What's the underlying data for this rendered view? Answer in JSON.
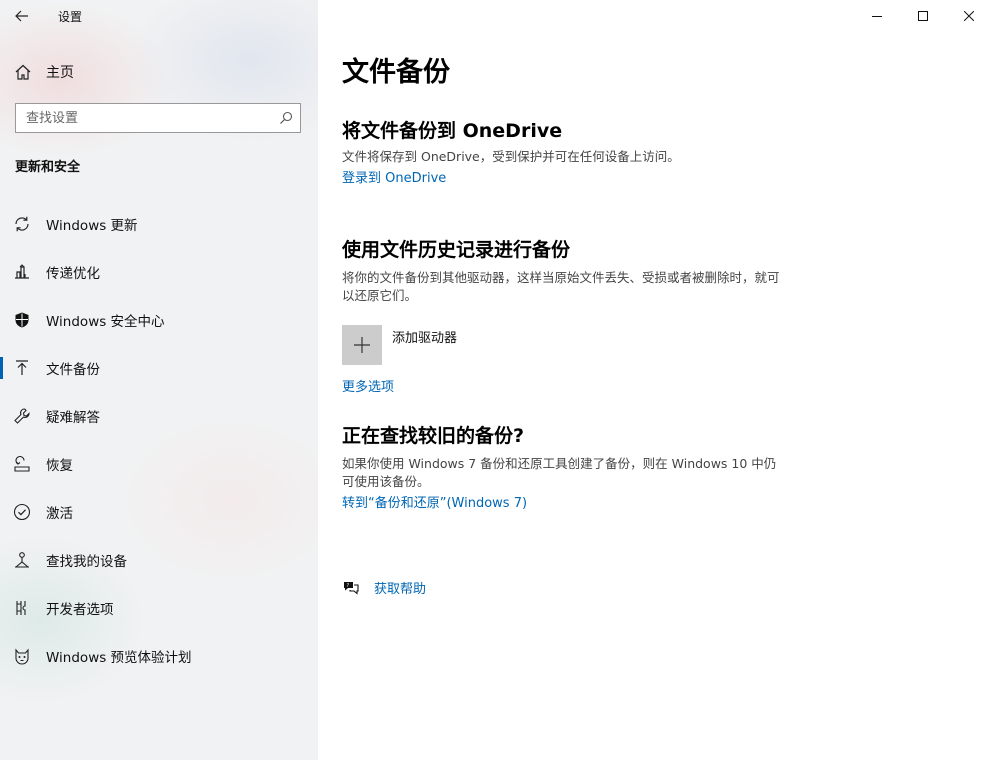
{
  "window": {
    "title": "设置"
  },
  "sidebar": {
    "home_label": "主页",
    "search_placeholder": "查找设置",
    "section_heading": "更新和安全",
    "items": [
      {
        "label": "Windows 更新",
        "icon": "sync-icon"
      },
      {
        "label": "传递优化",
        "icon": "delivery-optimization-icon"
      },
      {
        "label": "Windows 安全中心",
        "icon": "shield-icon"
      },
      {
        "label": "文件备份",
        "icon": "backup-arrow-icon",
        "active": true
      },
      {
        "label": "疑难解答",
        "icon": "wrench-icon"
      },
      {
        "label": "恢复",
        "icon": "recovery-icon"
      },
      {
        "label": "激活",
        "icon": "check-circle-icon"
      },
      {
        "label": "查找我的设备",
        "icon": "find-device-icon"
      },
      {
        "label": "开发者选项",
        "icon": "developer-icon"
      },
      {
        "label": "Windows 预览体验计划",
        "icon": "insider-cat-icon"
      }
    ]
  },
  "main": {
    "title": "文件备份",
    "onedrive": {
      "heading": "将文件备份到 OneDrive",
      "description": "文件将保存到 OneDrive，受到保护并可在任何设备上访问。",
      "link": "登录到 OneDrive"
    },
    "file_history": {
      "heading": "使用文件历史记录进行备份",
      "description": "将你的文件备份到其他驱动器，这样当原始文件丢失、受损或者被删除时，就可以还原它们。",
      "add_drive_label": "添加驱动器",
      "more_options_link": "更多选项"
    },
    "older_backup": {
      "heading": "正在查找较旧的备份?",
      "description": "如果你使用 Windows 7 备份和还原工具创建了备份，则在 Windows 10 中仍可使用该备份。",
      "link": "转到“备份和还原”(Windows 7)"
    },
    "help_label": "获取帮助"
  },
  "colors": {
    "accent": "#0063b1",
    "link": "#0066b4",
    "tile": "#cccccc"
  }
}
